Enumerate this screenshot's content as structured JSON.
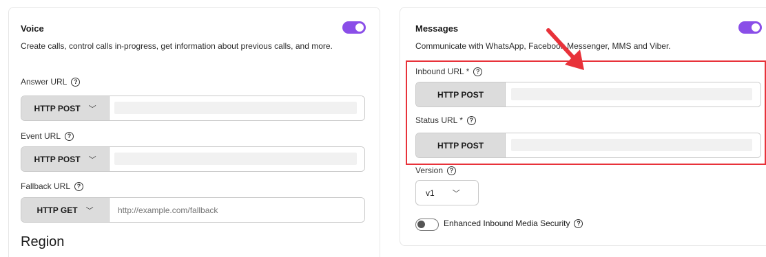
{
  "voice": {
    "title": "Voice",
    "description": "Create calls, control calls in-progress, get information about previous calls, and more.",
    "answer_url": {
      "label": "Answer URL",
      "method": "HTTP POST",
      "value": ""
    },
    "event_url": {
      "label": "Event URL",
      "method": "HTTP POST",
      "value": ""
    },
    "fallback_url": {
      "label": "Fallback URL",
      "method": "HTTP GET",
      "placeholder": "http://example.com/fallback"
    },
    "region_heading": "Region",
    "enabled": true
  },
  "messages": {
    "title": "Messages",
    "description": "Communicate with WhatsApp, Facebook Messenger, MMS and Viber.",
    "inbound_url": {
      "label": "Inbound URL *",
      "method": "HTTP POST",
      "value": ""
    },
    "status_url": {
      "label": "Status URL *",
      "method": "HTTP POST",
      "value": ""
    },
    "version": {
      "label": "Version",
      "value": "v1"
    },
    "security": {
      "label": "Enhanced Inbound Media Security",
      "enabled": false
    },
    "enabled": true
  },
  "icons": {
    "help": "?",
    "chevron": "﹀"
  },
  "colors": {
    "toggle_on": "#8a4ee8",
    "highlight": "#e8323a",
    "method_bg": "#dcdcdc"
  }
}
